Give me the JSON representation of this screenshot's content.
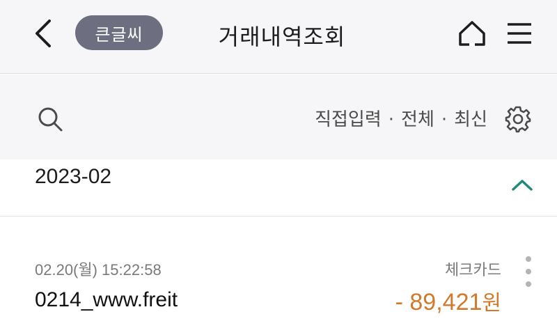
{
  "header": {
    "back_icon": "chevron-left-icon",
    "bigfont_label": "큰글씨",
    "title": "거래내역조회",
    "home_icon": "home-icon",
    "menu_icon": "hamburger-menu-icon"
  },
  "filter": {
    "search_icon": "search-icon",
    "range": "직접입력",
    "separator": "·",
    "scope": "전체",
    "order": "최신",
    "settings_icon": "gear-icon"
  },
  "month_group": {
    "label": "2023-02",
    "collapse_icon": "chevron-up-icon"
  },
  "transactions": [
    {
      "datetime": "02.20(월) 15:22:58",
      "type": "체크카드",
      "merchant": "0214_www.freit",
      "amount": "- 89,421",
      "currency": "원",
      "more_icon": "more-vertical-icon"
    }
  ],
  "colors": {
    "header_bg": "#f6f6f8",
    "pill_bg": "#6d6f81",
    "accent_teal": "#1f8a7c",
    "amount_orange": "#d07a2c"
  }
}
